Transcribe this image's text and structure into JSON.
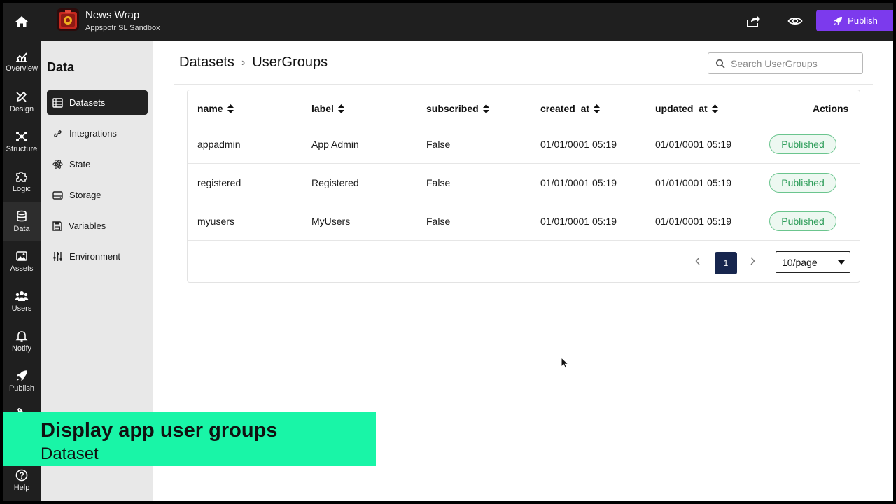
{
  "app": {
    "name": "News Wrap",
    "subtitle": "Appspotr SL Sandbox"
  },
  "topbar": {
    "publish_label": "Publish",
    "accent": "#7c3aed"
  },
  "rail": {
    "items": [
      {
        "label": "Overview",
        "icon": "chart-icon"
      },
      {
        "label": "Design",
        "icon": "pen-icon"
      },
      {
        "label": "Structure",
        "icon": "structure-icon"
      },
      {
        "label": "Logic",
        "icon": "puzzle-icon"
      },
      {
        "label": "Data",
        "icon": "database-icon",
        "active": true
      },
      {
        "label": "Assets",
        "icon": "image-icon"
      },
      {
        "label": "Users",
        "icon": "users-icon"
      },
      {
        "label": "Notify",
        "icon": "bell-icon"
      },
      {
        "label": "Publish",
        "icon": "rocket-icon"
      },
      {
        "label": "Help",
        "icon": "help-icon"
      }
    ]
  },
  "sidebar": {
    "title": "Data",
    "items": [
      {
        "label": "Datasets",
        "icon": "table-icon",
        "active": true
      },
      {
        "label": "Integrations",
        "icon": "link-icon"
      },
      {
        "label": "State",
        "icon": "atom-icon"
      },
      {
        "label": "Storage",
        "icon": "storage-icon"
      },
      {
        "label": "Variables",
        "icon": "save-icon"
      },
      {
        "label": "Environment",
        "icon": "sliders-icon"
      }
    ]
  },
  "breadcrumb": {
    "root": "Datasets",
    "current": "UserGroups"
  },
  "search": {
    "placeholder": "Search UserGroups"
  },
  "table": {
    "columns": [
      "name",
      "label",
      "subscribed",
      "created_at",
      "updated_at",
      "Actions"
    ],
    "rows": [
      {
        "name": "appadmin",
        "label": "App Admin",
        "subscribed": "False",
        "created_at": "01/01/0001 05:19",
        "updated_at": "01/01/0001 05:19",
        "status": "Published"
      },
      {
        "name": "registered",
        "label": "Registered",
        "subscribed": "False",
        "created_at": "01/01/0001 05:19",
        "updated_at": "01/01/0001 05:19",
        "status": "Published"
      },
      {
        "name": "myusers",
        "label": "MyUsers",
        "subscribed": "False",
        "created_at": "01/01/0001 05:19",
        "updated_at": "01/01/0001 05:19",
        "status": "Published"
      }
    ],
    "status_color": "#2f9e5b"
  },
  "pagination": {
    "current_page": "1",
    "page_size": "10/page"
  },
  "banner": {
    "title": "Display app user groups",
    "subtitle": "Dataset",
    "color": "#19f5a7"
  }
}
